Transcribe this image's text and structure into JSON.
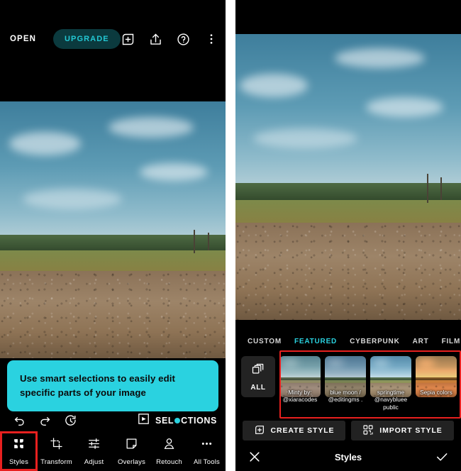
{
  "app": {
    "header": {
      "open_label": "OPEN",
      "upgrade_label": "UPGRADE",
      "icons": [
        "add-icon",
        "export-icon",
        "help-icon",
        "overflow-menu-icon"
      ]
    },
    "tooltip": {
      "text": "Use smart selections to easily edit specific parts of your image",
      "background": "#2ad2e0"
    },
    "history": {
      "undo": "undo-icon",
      "redo": "redo-icon",
      "reset": "reset-icon",
      "selections_badge": {
        "prefix": "SEL",
        "suffix": "CTIONS"
      }
    },
    "toolbar": {
      "selected": "Styles",
      "highlight_color": "#e8201f",
      "items": [
        {
          "label": "Styles",
          "icon": "styles-icon",
          "selected": true
        },
        {
          "label": "Transform",
          "icon": "transform-icon",
          "selected": false
        },
        {
          "label": "Adjust",
          "icon": "adjust-icon",
          "selected": false
        },
        {
          "label": "Overlays",
          "icon": "overlays-icon",
          "selected": false
        },
        {
          "label": "Retouch",
          "icon": "retouch-icon",
          "selected": false
        },
        {
          "label": "All Tools",
          "icon": "all-tools-icon",
          "selected": false
        }
      ]
    }
  },
  "styles_panel": {
    "accent": "#2ad2e0",
    "tabs": [
      {
        "label": "CUSTOM",
        "active": false
      },
      {
        "label": "FEATURED",
        "active": true
      },
      {
        "label": "CYBERPUNK",
        "active": false
      },
      {
        "label": "ART",
        "active": false
      },
      {
        "label": "FILM",
        "active": false
      }
    ],
    "tabs_overflow": "⋮",
    "all_button": {
      "label": "ALL",
      "icon": "stacked-squares-icon"
    },
    "presets": [
      {
        "name": "Minty by:\n@xiaracodes",
        "filter": "filt-minty"
      },
      {
        "name": "blue moon\n/\n@editingms\n.",
        "filter": "filt-blue"
      },
      {
        "name": "springtime\n@navybluee\npublic",
        "filter": "filt-spring"
      },
      {
        "name": "Sepia\ncolors",
        "filter": "filt-sepia"
      }
    ],
    "actions": [
      {
        "label": "CREATE STYLE",
        "icon": "add-icon"
      },
      {
        "label": "IMPORT STYLE",
        "icon": "qr-code-icon"
      }
    ],
    "confirm_bar": {
      "title": "Styles",
      "cancel_icon": "close-icon",
      "accept_icon": "check-icon"
    }
  }
}
